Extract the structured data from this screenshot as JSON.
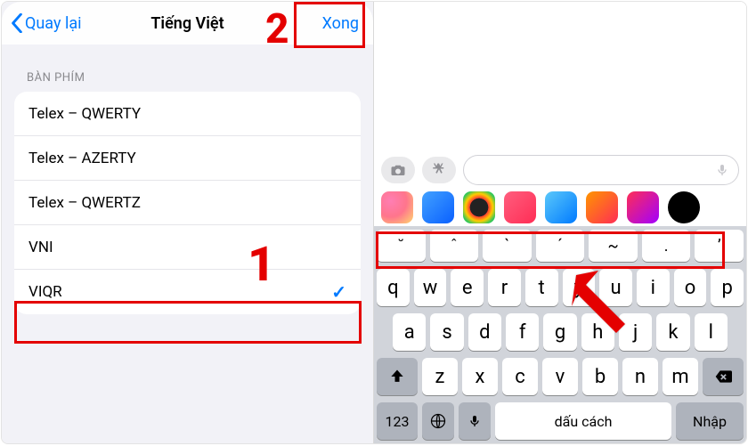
{
  "annotations": {
    "step1": "1",
    "step2": "2"
  },
  "left": {
    "back_label": "Quay lại",
    "title": "Tiếng Việt",
    "done_label": "Xong",
    "section_header": "BÀN PHÍM",
    "options": [
      {
        "label": "Telex – QWERTY",
        "selected": false
      },
      {
        "label": "Telex – AZERTY",
        "selected": false
      },
      {
        "label": "Telex – QWERTZ",
        "selected": false
      },
      {
        "label": "VNI",
        "selected": false
      },
      {
        "label": "VIQR",
        "selected": true
      }
    ],
    "check_glyph": "✓"
  },
  "keyboard": {
    "tone_row": [
      "˘",
      "ˆ",
      "`",
      "´",
      "~",
      ".",
      "ʼ"
    ],
    "row1": [
      "q",
      "w",
      "e",
      "r",
      "t",
      "y",
      "u",
      "i",
      "o",
      "p"
    ],
    "row2": [
      "a",
      "s",
      "d",
      "f",
      "g",
      "h",
      "j",
      "k",
      "l"
    ],
    "row3": [
      "z",
      "x",
      "c",
      "v",
      "b",
      "n",
      "m"
    ],
    "num_label": "123",
    "space_label": "dấu cách",
    "return_label": "Nhập"
  },
  "colors": {
    "accent": "#007aff",
    "annotation": "#e40000"
  }
}
